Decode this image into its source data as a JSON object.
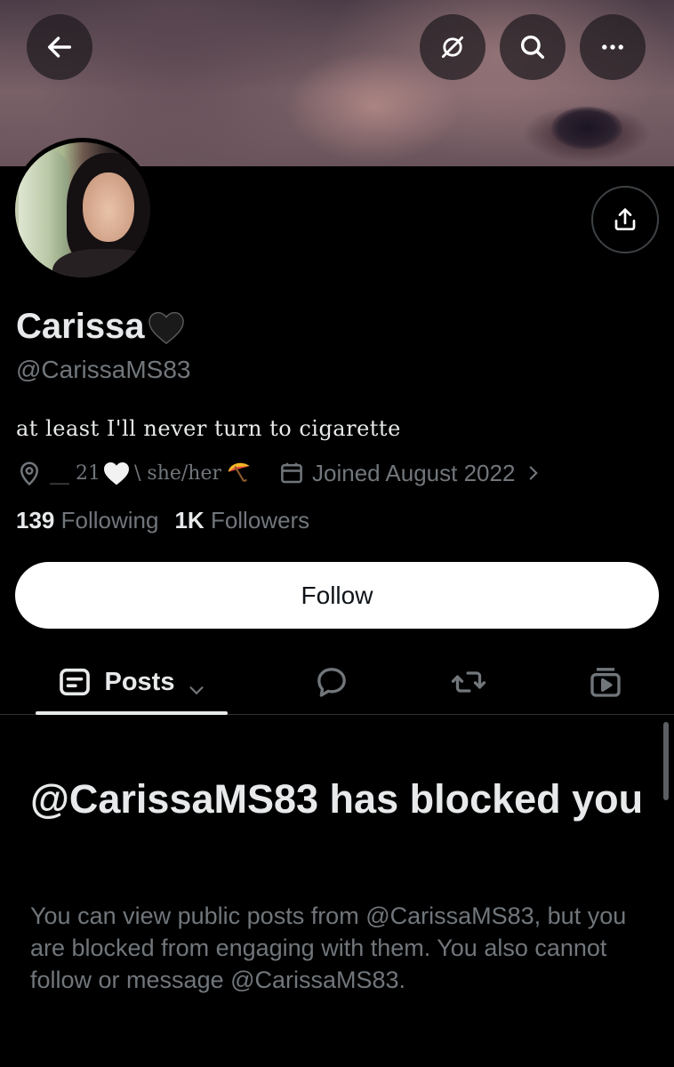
{
  "profile": {
    "display_name": "Carissa",
    "handle": "@CarissaMS83",
    "bio": "at least I'll never turn to cigarette",
    "location": "__ 21",
    "pronouns": "\\ she/her",
    "joined": "Joined August 2022",
    "following_count": "139",
    "following_label": "Following",
    "followers_count": "1K",
    "followers_label": "Followers"
  },
  "actions": {
    "follow_label": "Follow"
  },
  "tabs": {
    "posts_label": "Posts",
    "items": [
      "posts",
      "replies",
      "reposts",
      "media"
    ],
    "active": "posts"
  },
  "blocked": {
    "title": "@CarissaMS83 has blocked you",
    "description": "You can view public posts from @CarissaMS83, but you are blocked from engaging with them. You also cannot follow or message @CarissaMS83."
  },
  "icons": {
    "back": "arrow-left-icon",
    "grok": "grok-icon",
    "search": "search-icon",
    "more": "more-icon",
    "share": "share-icon",
    "location": "location-pin-icon",
    "calendar": "calendar-icon",
    "posts_tab": "posts-icon",
    "replies_tab": "reply-bubble-icon",
    "reposts_tab": "repost-icon",
    "media_tab": "media-icon"
  },
  "colors": {
    "background": "#000000",
    "primary_text": "#e7e9ea",
    "secondary_text": "#71767b",
    "follow_button_bg": "#ffffff",
    "divider": "#2f3336"
  }
}
